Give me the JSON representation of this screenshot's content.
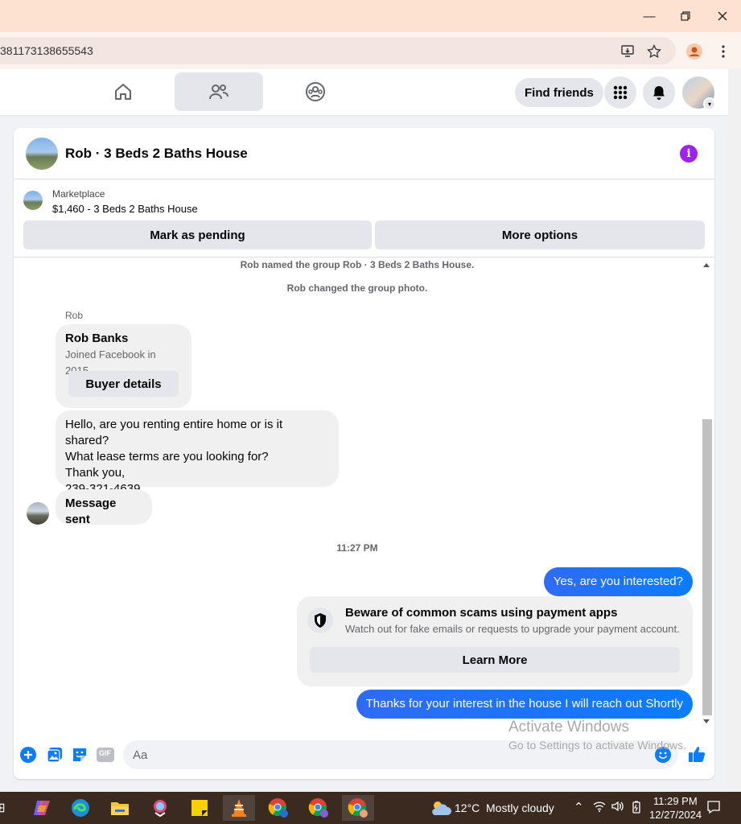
{
  "browser": {
    "url_fragment": "381173138655543"
  },
  "nav": {
    "find_friends": "Find friends"
  },
  "chat": {
    "title": "Rob · 3 Beds 2 Baths House",
    "marketplace_label": "Marketplace",
    "listing": "$1,460 - 3 Beds 2 Baths House",
    "mark_pending": "Mark as pending",
    "more_options": "More options",
    "system_messages": [
      "Rob named the group Rob · 3 Beds 2 Baths House.",
      "Rob changed the group photo."
    ],
    "sender": "Rob",
    "profile_name": "Rob Banks",
    "profile_joined": "Joined Facebook in 2015",
    "buyer_details": "Buyer details",
    "incoming_lines": [
      "Hello, are you renting entire home or is it shared?",
      "What lease terms are you looking for?",
      "Thank you,",
      "239-321-4639"
    ],
    "message_sent": "Message sent",
    "timestamp": "11:27 PM",
    "outgoing_1": "Yes, are you interested?",
    "scam_title": "Beware of common scams using payment apps",
    "scam_text": "Watch out for fake emails or requests to upgrade your payment account.",
    "learn_more": "Learn More",
    "outgoing_2": "Thanks for your interest in the house I will reach out Shortly",
    "composer_placeholder": "Aa",
    "gif_label": "GIF"
  },
  "watermark": {
    "line1": "Activate Windows",
    "line2": "Go to Settings to activate Windows."
  },
  "taskbar": {
    "weather_temp": "12°C",
    "weather_text": "Mostly cloudy",
    "time": "11:29 PM",
    "date": "12/27/2024"
  },
  "colors": {
    "accent_blue": "#0a7cff",
    "info_purple": "#a020f0",
    "titlebar": "#fde2d2"
  }
}
